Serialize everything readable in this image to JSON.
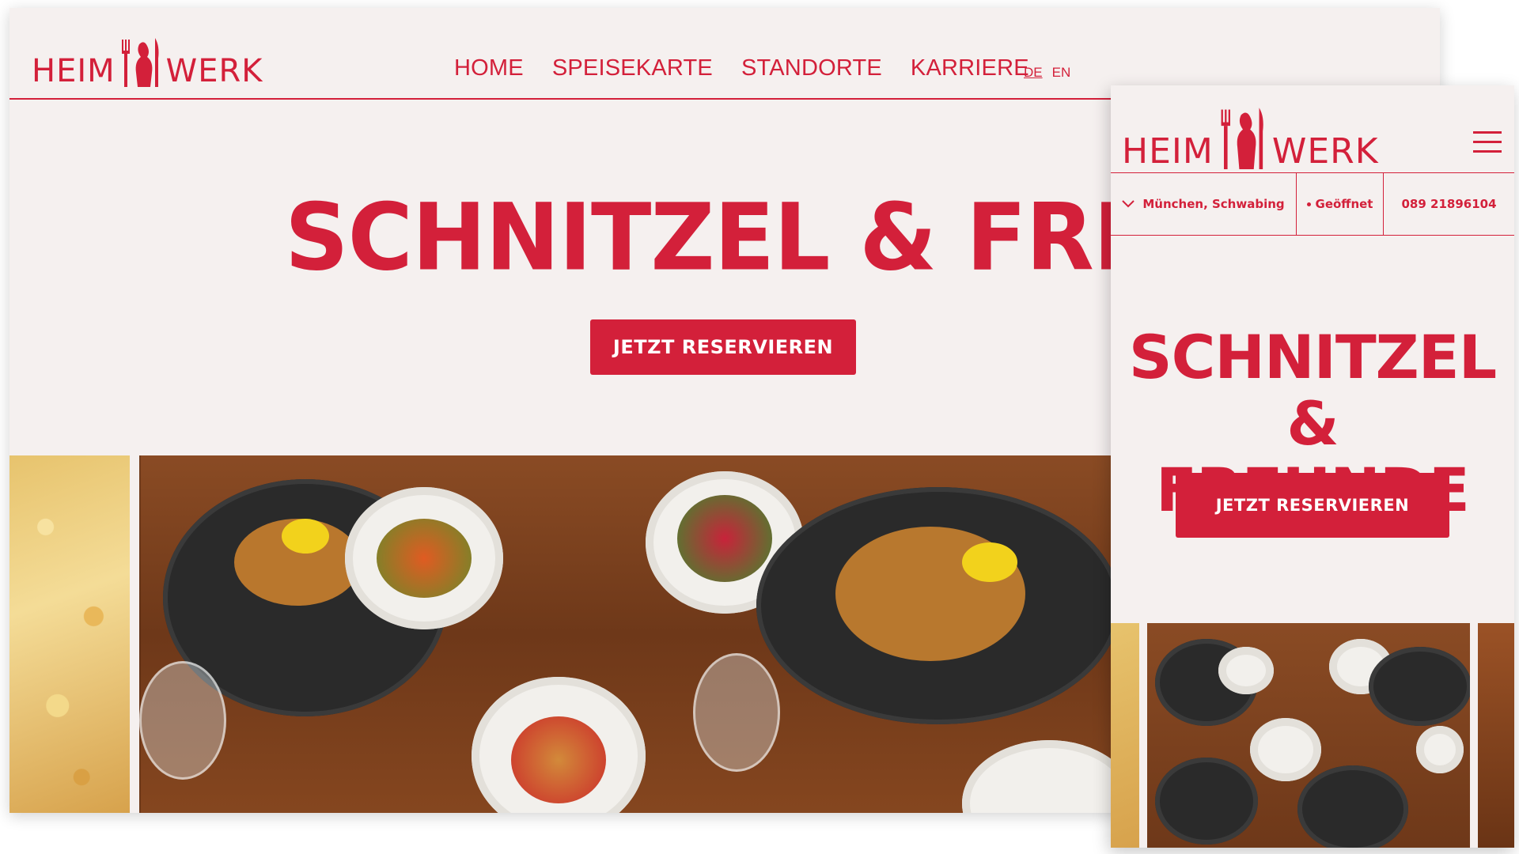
{
  "desktop": {
    "logo": {
      "left": "HEIM",
      "right": "WERK"
    },
    "nav": [
      "HOME",
      "SPEISEKARTE",
      "STANDORTE",
      "KARRIERE"
    ],
    "languages": [
      "DE",
      "EN"
    ],
    "active_language": "DE",
    "hero_title": "SCHNITZEL & FREUND",
    "cta": "JETZT RESERVIEREN"
  },
  "mobile": {
    "logo": {
      "left": "HEIM",
      "right": "WERK"
    },
    "location": "München, Schwabing",
    "status": "Geöffnet",
    "phone": "089 21896104",
    "hero_title_line1": "SCHNITZEL &",
    "hero_title_line2": "FREUNDE",
    "cta": "JETZT RESERVIEREN"
  },
  "colors": {
    "brand_red": "#d3203a",
    "background": "#f5f0ef"
  },
  "icons": [
    "fork-bear-knife-logo-icon",
    "hamburger-menu-icon",
    "chevron-down-icon",
    "status-dot-icon"
  ]
}
